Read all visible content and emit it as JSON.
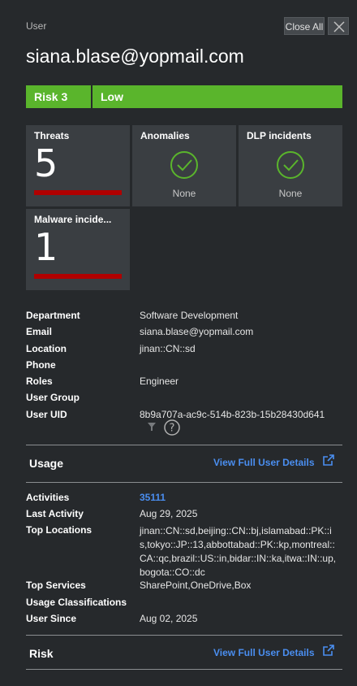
{
  "header": {
    "label": "User",
    "close_all": "Close All",
    "email": "siana.blase@yopmail.com"
  },
  "risk": {
    "left": "Risk 3",
    "right": "Low",
    "color": "#5ab52c"
  },
  "cards": {
    "threats": {
      "title": "Threats",
      "value": "5"
    },
    "anomalies": {
      "title": "Anomalies",
      "status": "None"
    },
    "dlp": {
      "title": "DLP incidents",
      "status": "None"
    },
    "malware": {
      "title": "Malware incide...",
      "value": "1"
    }
  },
  "details": {
    "department": {
      "k": "Department",
      "v": "Software Development"
    },
    "email": {
      "k": "Email",
      "v": "siana.blase@yopmail.com"
    },
    "location": {
      "k": "Location",
      "v": "jinan::CN::sd"
    },
    "phone": {
      "k": "Phone",
      "v": ""
    },
    "roles": {
      "k": "Roles",
      "v": "Engineer"
    },
    "user_group": {
      "k": "User Group",
      "v": ""
    },
    "user_uid": {
      "k": "User UID",
      "v": "8b9a707a-ac9c-514b-823b-15b28430d641"
    }
  },
  "usage": {
    "title": "Usage",
    "link": "View Full User Details",
    "activities": {
      "k": "Activities",
      "v": "35111"
    },
    "last_activity": {
      "k": "Last Activity",
      "v": "Aug 29, 2025"
    },
    "top_locations": {
      "k": "Top Locations",
      "v": "jinan::CN::sd,beijing::CN::bj,islamabad::PK::is,tokyo::JP::13,abbottabad::PK::kp,montreal::CA::qc,brazil::US::in,bidar::IN::ka,itwa::IN::up,bogota::CO::dc"
    },
    "top_services": {
      "k": "Top Services",
      "v": "SharePoint,OneDrive,Box"
    },
    "usage_classifications": {
      "k": "Usage Classifications",
      "v": ""
    },
    "user_since": {
      "k": "User Since",
      "v": "Aug 02, 2025"
    }
  },
  "risk_section": {
    "title": "Risk",
    "link": "View Full User Details"
  },
  "colors": {
    "background": "#26292c",
    "card": "#3a3e42",
    "link": "#4a8ef0",
    "threat_bar": "#b00000",
    "check": "#5ab52c"
  }
}
